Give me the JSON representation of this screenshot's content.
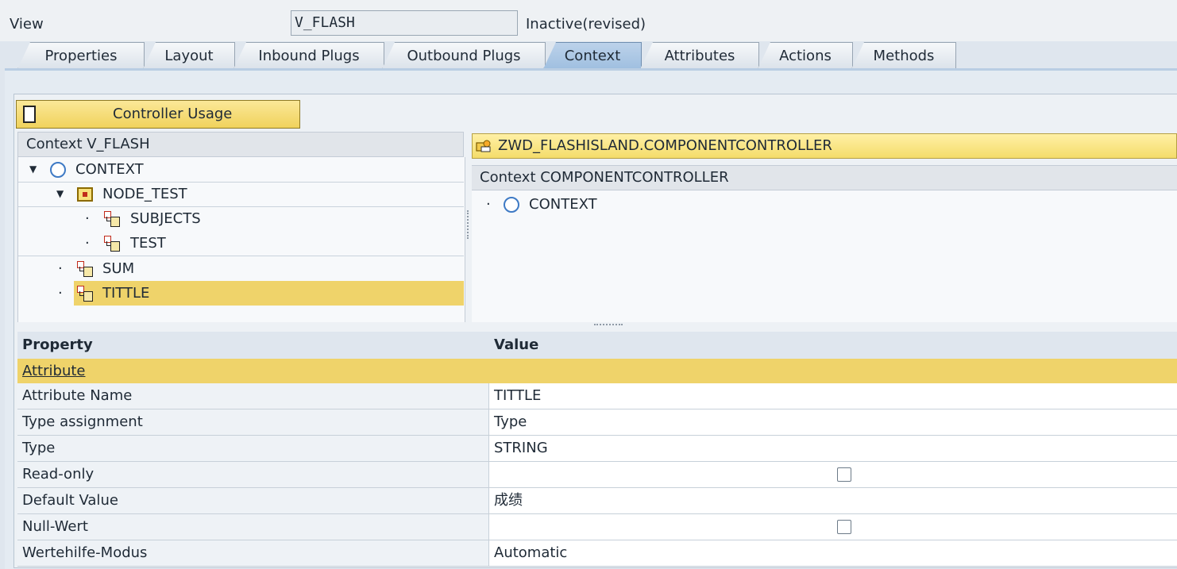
{
  "header": {
    "view_label": "View",
    "view_value": "V_FLASH",
    "status": "Inactive(revised)"
  },
  "tabs": [
    {
      "label": "Properties"
    },
    {
      "label": "Layout"
    },
    {
      "label": "Inbound Plugs"
    },
    {
      "label": "Outbound Plugs"
    },
    {
      "label": "Context"
    },
    {
      "label": "Attributes"
    },
    {
      "label": "Actions"
    },
    {
      "label": "Methods"
    }
  ],
  "active_tab": "Context",
  "controller_usage_label": "Controller Usage",
  "left_panel": {
    "header": "Context V_FLASH",
    "tree": [
      {
        "label": "CONTEXT",
        "icon": "context-circle-icon"
      },
      {
        "label": "NODE_TEST",
        "icon": "node-icon"
      },
      {
        "label": "SUBJECTS",
        "icon": "attribute-icon"
      },
      {
        "label": "TEST",
        "icon": "attribute-icon"
      },
      {
        "label": "SUM",
        "icon": "attribute-icon"
      },
      {
        "label": "TITTLE",
        "icon": "attribute-icon"
      }
    ],
    "selected": "TITTLE"
  },
  "right_panel": {
    "controller_name": "ZWD_FLASHISLAND.COMPONENTCONTROLLER",
    "header": "Context COMPONENTCONTROLLER",
    "tree": [
      {
        "label": "CONTEXT",
        "icon": "context-circle-icon"
      }
    ]
  },
  "properties": {
    "col_property": "Property",
    "col_value": "Value",
    "group": "Attribute",
    "rows": [
      {
        "name": "Attribute Name",
        "value": "TITTLE"
      },
      {
        "name": "Type assignment",
        "value": "Type"
      },
      {
        "name": "Type",
        "value": "STRING"
      },
      {
        "name": "Read-only",
        "value": "",
        "checked": false
      },
      {
        "name": "Default Value",
        "value": "成绩"
      },
      {
        "name": "Null-Wert",
        "value": "",
        "checked": false
      },
      {
        "name": "Wertehilfe-Modus",
        "value": "Automatic"
      }
    ]
  },
  "colors": {
    "accent_yellow": "#efd36a",
    "active_tab": "#a9c6e6",
    "context_circle": "#3e7ac5"
  }
}
